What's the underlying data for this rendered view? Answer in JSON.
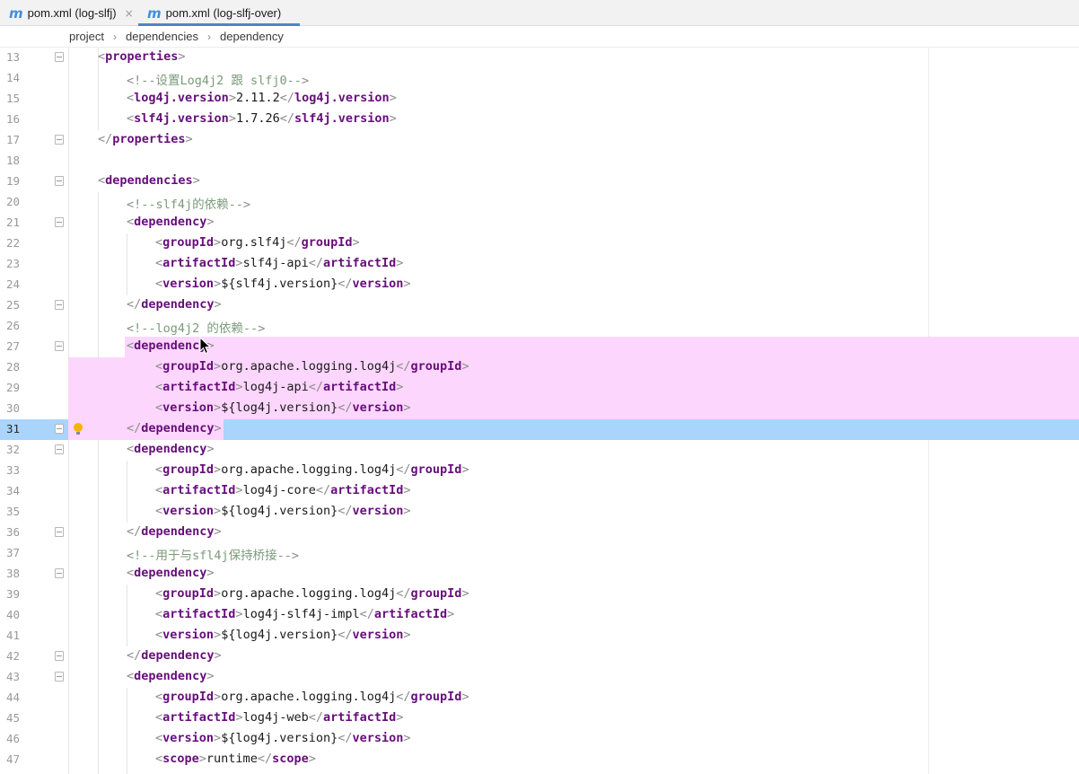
{
  "tabs": [
    {
      "label": "pom.xml (log-slfj)",
      "icon": "maven-m-icon",
      "glyph": "m",
      "close": "×",
      "active": false
    },
    {
      "label": "pom.xml (log-slfj-over)",
      "icon": "maven-m-icon",
      "glyph": "m",
      "active": true
    }
  ],
  "breadcrumb": [
    "project",
    "dependencies",
    "dependency"
  ],
  "breadcrumb_separator": "›",
  "colors": {
    "tag": "#660e7a",
    "bracket": "#8c8c8c",
    "comment": "#7a9a7a",
    "selection": "#fcd6fc",
    "caret_line": "#a9d4fb",
    "active_tab_underline": "#4a86c8",
    "bulb": "#f5b400"
  },
  "lines": [
    {
      "n": "13",
      "indent": 1,
      "fold": true,
      "parts": [
        [
          "br",
          "<"
        ],
        [
          "tag",
          "properties"
        ],
        [
          "br",
          ">"
        ]
      ]
    },
    {
      "n": "14",
      "indent": 2,
      "fold": false,
      "parts": [
        [
          "br",
          "<"
        ],
        [
          "comment",
          "!--设置Log4j2 跟 slfj0--"
        ],
        [
          "br",
          ">"
        ]
      ]
    },
    {
      "n": "15",
      "indent": 2,
      "fold": false,
      "parts": [
        [
          "br",
          "<"
        ],
        [
          "tag",
          "log4j.version"
        ],
        [
          "br",
          ">"
        ],
        [
          "text",
          "2.11.2"
        ],
        [
          "br",
          "</"
        ],
        [
          "tag",
          "log4j.version"
        ],
        [
          "br",
          ">"
        ]
      ]
    },
    {
      "n": "16",
      "indent": 2,
      "fold": false,
      "parts": [
        [
          "br",
          "<"
        ],
        [
          "tag",
          "slf4j.version"
        ],
        [
          "br",
          ">"
        ],
        [
          "text",
          "1.7.26"
        ],
        [
          "br",
          "</"
        ],
        [
          "tag",
          "slf4j.version"
        ],
        [
          "br",
          ">"
        ]
      ]
    },
    {
      "n": "17",
      "indent": 1,
      "fold": true,
      "parts": [
        [
          "br",
          "</"
        ],
        [
          "tag",
          "properties"
        ],
        [
          "br",
          ">"
        ]
      ]
    },
    {
      "n": "18",
      "indent": 0,
      "fold": false,
      "parts": []
    },
    {
      "n": "19",
      "indent": 1,
      "fold": true,
      "parts": [
        [
          "br",
          "<"
        ],
        [
          "tag",
          "dependencies"
        ],
        [
          "br",
          ">"
        ]
      ]
    },
    {
      "n": "20",
      "indent": 2,
      "fold": false,
      "parts": [
        [
          "br",
          "<"
        ],
        [
          "comment",
          "!--slf4j的依赖--"
        ],
        [
          "br",
          ">"
        ]
      ]
    },
    {
      "n": "21",
      "indent": 2,
      "fold": true,
      "parts": [
        [
          "br",
          "<"
        ],
        [
          "tag",
          "dependency"
        ],
        [
          "br",
          ">"
        ]
      ]
    },
    {
      "n": "22",
      "indent": 3,
      "fold": false,
      "parts": [
        [
          "br",
          "<"
        ],
        [
          "tag",
          "groupId"
        ],
        [
          "br",
          ">"
        ],
        [
          "text",
          "org.slf4j"
        ],
        [
          "br",
          "</"
        ],
        [
          "tag",
          "groupId"
        ],
        [
          "br",
          ">"
        ]
      ]
    },
    {
      "n": "23",
      "indent": 3,
      "fold": false,
      "parts": [
        [
          "br",
          "<"
        ],
        [
          "tag",
          "artifactId"
        ],
        [
          "br",
          ">"
        ],
        [
          "text",
          "slf4j-api"
        ],
        [
          "br",
          "</"
        ],
        [
          "tag",
          "artifactId"
        ],
        [
          "br",
          ">"
        ]
      ]
    },
    {
      "n": "24",
      "indent": 3,
      "fold": false,
      "parts": [
        [
          "br",
          "<"
        ],
        [
          "tag",
          "version"
        ],
        [
          "br",
          ">"
        ],
        [
          "text",
          "${slf4j.version}"
        ],
        [
          "br",
          "</"
        ],
        [
          "tag",
          "version"
        ],
        [
          "br",
          ">"
        ]
      ]
    },
    {
      "n": "25",
      "indent": 2,
      "fold": true,
      "parts": [
        [
          "br",
          "</"
        ],
        [
          "tag",
          "dependency"
        ],
        [
          "br",
          ">"
        ]
      ]
    },
    {
      "n": "26",
      "indent": 2,
      "fold": false,
      "parts": [
        [
          "br",
          "<"
        ],
        [
          "comment",
          "!--log4j2 的依赖--"
        ],
        [
          "br",
          ">"
        ]
      ]
    },
    {
      "n": "27",
      "indent": 2,
      "fold": true,
      "parts": [
        [
          "br",
          "<"
        ],
        [
          "tag",
          "dependency"
        ],
        [
          "br",
          ">"
        ]
      ],
      "sel": "first"
    },
    {
      "n": "28",
      "indent": 3,
      "fold": false,
      "parts": [
        [
          "br",
          "<"
        ],
        [
          "tag",
          "groupId"
        ],
        [
          "br",
          ">"
        ],
        [
          "text",
          "org.apache.logging.log4j"
        ],
        [
          "br",
          "</"
        ],
        [
          "tag",
          "groupId"
        ],
        [
          "br",
          ">"
        ]
      ],
      "sel": "full"
    },
    {
      "n": "29",
      "indent": 3,
      "fold": false,
      "parts": [
        [
          "br",
          "<"
        ],
        [
          "tag",
          "artifactId"
        ],
        [
          "br",
          ">"
        ],
        [
          "text",
          "log4j-api"
        ],
        [
          "br",
          "</"
        ],
        [
          "tag",
          "artifactId"
        ],
        [
          "br",
          ">"
        ]
      ],
      "sel": "full"
    },
    {
      "n": "30",
      "indent": 3,
      "fold": false,
      "parts": [
        [
          "br",
          "<"
        ],
        [
          "tag",
          "version"
        ],
        [
          "br",
          ">"
        ],
        [
          "text",
          "${log4j.version}"
        ],
        [
          "br",
          "</"
        ],
        [
          "tag",
          "version"
        ],
        [
          "br",
          ">"
        ]
      ],
      "sel": "full"
    },
    {
      "n": "31",
      "indent": 2,
      "fold": true,
      "parts": [
        [
          "br",
          "</"
        ],
        [
          "tag",
          "dependency"
        ],
        [
          "br",
          ">"
        ]
      ],
      "sel": "last",
      "caret": true,
      "bulb": true
    },
    {
      "n": "32",
      "indent": 2,
      "fold": true,
      "parts": [
        [
          "br",
          "<"
        ],
        [
          "tag",
          "dependency"
        ],
        [
          "br",
          ">"
        ]
      ]
    },
    {
      "n": "33",
      "indent": 3,
      "fold": false,
      "parts": [
        [
          "br",
          "<"
        ],
        [
          "tag",
          "groupId"
        ],
        [
          "br",
          ">"
        ],
        [
          "text",
          "org.apache.logging.log4j"
        ],
        [
          "br",
          "</"
        ],
        [
          "tag",
          "groupId"
        ],
        [
          "br",
          ">"
        ]
      ]
    },
    {
      "n": "34",
      "indent": 3,
      "fold": false,
      "parts": [
        [
          "br",
          "<"
        ],
        [
          "tag",
          "artifactId"
        ],
        [
          "br",
          ">"
        ],
        [
          "text",
          "log4j-core"
        ],
        [
          "br",
          "</"
        ],
        [
          "tag",
          "artifactId"
        ],
        [
          "br",
          ">"
        ]
      ]
    },
    {
      "n": "35",
      "indent": 3,
      "fold": false,
      "parts": [
        [
          "br",
          "<"
        ],
        [
          "tag",
          "version"
        ],
        [
          "br",
          ">"
        ],
        [
          "text",
          "${log4j.version}"
        ],
        [
          "br",
          "</"
        ],
        [
          "tag",
          "version"
        ],
        [
          "br",
          ">"
        ]
      ]
    },
    {
      "n": "36",
      "indent": 2,
      "fold": true,
      "parts": [
        [
          "br",
          "</"
        ],
        [
          "tag",
          "dependency"
        ],
        [
          "br",
          ">"
        ]
      ]
    },
    {
      "n": "37",
      "indent": 2,
      "fold": false,
      "parts": [
        [
          "br",
          "<"
        ],
        [
          "comment",
          "!--用于与sfl4j保持桥接--"
        ],
        [
          "br",
          ">"
        ]
      ]
    },
    {
      "n": "38",
      "indent": 2,
      "fold": true,
      "parts": [
        [
          "br",
          "<"
        ],
        [
          "tag",
          "dependency"
        ],
        [
          "br",
          ">"
        ]
      ]
    },
    {
      "n": "39",
      "indent": 3,
      "fold": false,
      "parts": [
        [
          "br",
          "<"
        ],
        [
          "tag",
          "groupId"
        ],
        [
          "br",
          ">"
        ],
        [
          "text",
          "org.apache.logging.log4j"
        ],
        [
          "br",
          "</"
        ],
        [
          "tag",
          "groupId"
        ],
        [
          "br",
          ">"
        ]
      ]
    },
    {
      "n": "40",
      "indent": 3,
      "fold": false,
      "parts": [
        [
          "br",
          "<"
        ],
        [
          "tag",
          "artifactId"
        ],
        [
          "br",
          ">"
        ],
        [
          "text",
          "log4j-slf4j-impl"
        ],
        [
          "br",
          "</"
        ],
        [
          "tag",
          "artifactId"
        ],
        [
          "br",
          ">"
        ]
      ]
    },
    {
      "n": "41",
      "indent": 3,
      "fold": false,
      "parts": [
        [
          "br",
          "<"
        ],
        [
          "tag",
          "version"
        ],
        [
          "br",
          ">"
        ],
        [
          "text",
          "${log4j.version}"
        ],
        [
          "br",
          "</"
        ],
        [
          "tag",
          "version"
        ],
        [
          "br",
          ">"
        ]
      ]
    },
    {
      "n": "42",
      "indent": 2,
      "fold": true,
      "parts": [
        [
          "br",
          "</"
        ],
        [
          "tag",
          "dependency"
        ],
        [
          "br",
          ">"
        ]
      ]
    },
    {
      "n": "43",
      "indent": 2,
      "fold": true,
      "parts": [
        [
          "br",
          "<"
        ],
        [
          "tag",
          "dependency"
        ],
        [
          "br",
          ">"
        ]
      ]
    },
    {
      "n": "44",
      "indent": 3,
      "fold": false,
      "parts": [
        [
          "br",
          "<"
        ],
        [
          "tag",
          "groupId"
        ],
        [
          "br",
          ">"
        ],
        [
          "text",
          "org.apache.logging.log4j"
        ],
        [
          "br",
          "</"
        ],
        [
          "tag",
          "groupId"
        ],
        [
          "br",
          ">"
        ]
      ]
    },
    {
      "n": "45",
      "indent": 3,
      "fold": false,
      "parts": [
        [
          "br",
          "<"
        ],
        [
          "tag",
          "artifactId"
        ],
        [
          "br",
          ">"
        ],
        [
          "text",
          "log4j-web"
        ],
        [
          "br",
          "</"
        ],
        [
          "tag",
          "artifactId"
        ],
        [
          "br",
          ">"
        ]
      ]
    },
    {
      "n": "46",
      "indent": 3,
      "fold": false,
      "parts": [
        [
          "br",
          "<"
        ],
        [
          "tag",
          "version"
        ],
        [
          "br",
          ">"
        ],
        [
          "text",
          "${log4j.version}"
        ],
        [
          "br",
          "</"
        ],
        [
          "tag",
          "version"
        ],
        [
          "br",
          ">"
        ]
      ]
    },
    {
      "n": "47",
      "indent": 3,
      "fold": false,
      "parts": [
        [
          "br",
          "<"
        ],
        [
          "tag",
          "scope"
        ],
        [
          "br",
          ">"
        ],
        [
          "text",
          "runtime"
        ],
        [
          "br",
          "</"
        ],
        [
          "tag",
          "scope"
        ],
        [
          "br",
          ">"
        ]
      ]
    }
  ]
}
